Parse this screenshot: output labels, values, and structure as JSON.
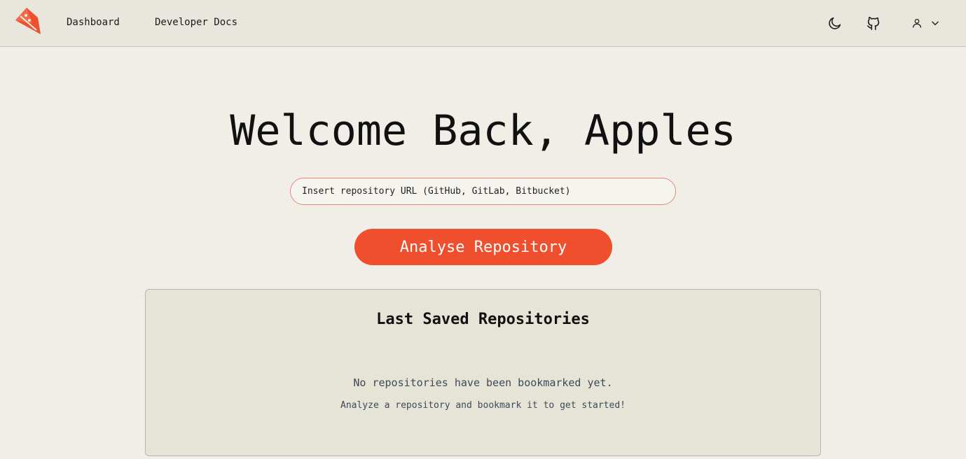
{
  "nav": {
    "logo_icon": "kite-logo-icon",
    "links": [
      {
        "label": "Dashboard"
      },
      {
        "label": "Developer Docs"
      }
    ],
    "icons": {
      "theme_toggle": "moon-icon",
      "github": "github-icon",
      "user": "user-icon",
      "dropdown": "chevron-down-icon"
    }
  },
  "main": {
    "welcome": "Welcome Back, Apples",
    "url_input": {
      "placeholder": "Insert repository URL (GitHub, GitLab, Bitbucket)",
      "value": ""
    },
    "analyse_button": "Analyse Repository"
  },
  "saved": {
    "title": "Last Saved Repositories",
    "empty_message": "No repositories have been bookmarked yet.",
    "empty_hint": "Analyze a repository and bookmark it to get started!"
  },
  "colors": {
    "accent": "#ef4f2c",
    "background": "#f0eee6",
    "navbar": "#e9e7dd",
    "panel": "#e6e3d7"
  }
}
